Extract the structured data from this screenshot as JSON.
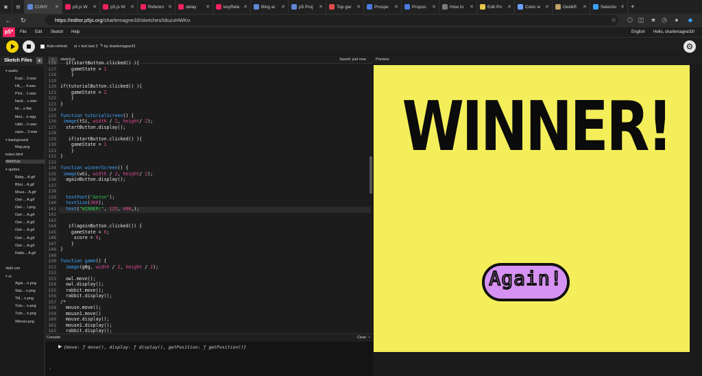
{
  "browser": {
    "tabs": [
      {
        "label": "CUNY",
        "color": "#5e88d8"
      },
      {
        "label": "p5.js W",
        "color": "#ed225d"
      },
      {
        "label": "p5.js W",
        "color": "#ed225d"
      },
      {
        "label": "Referen",
        "color": "#ed225d"
      },
      {
        "label": "delay",
        "color": "#ed225d"
      },
      {
        "label": "keyRele",
        "color": "#ed225d"
      },
      {
        "label": "Blog ar",
        "color": "#5e88d8"
      },
      {
        "label": "p5 Proj",
        "color": "#5e88d8"
      },
      {
        "label": "Top gar",
        "color": "#e34b4b"
      },
      {
        "label": "Prospe",
        "color": "#4b7be3"
      },
      {
        "label": "Propos",
        "color": "#4b7be3"
      },
      {
        "label": "How to",
        "color": "#7a7a7a"
      },
      {
        "label": "Edit Po",
        "color": "#e6c84a"
      },
      {
        "label": "Color w",
        "color": "#6aa0ff"
      },
      {
        "label": "Owl&R",
        "color": "#c2a06a"
      },
      {
        "label": "Selectio",
        "color": "#3aa2ff"
      }
    ],
    "url_host": "https://editor.p5js.org",
    "url_path": "/sharlemagne33/sketches/IduzuHWKo"
  },
  "header": {
    "logo": "p5*",
    "menu": [
      "File",
      "Edit",
      "Sketch",
      "Help"
    ],
    "language": "English",
    "user": "Hello, sharlemagne33!"
  },
  "toolbar": {
    "autorefresh_label": "Auto-refresh",
    "sketch_name": "ui + text test 2",
    "by_label": "by sharlemagne33"
  },
  "sidebar": {
    "title": "Sketch Files",
    "items": [
      {
        "label": "audio",
        "folder": true
      },
      {
        "label": "Expl... 3.wav"
      },
      {
        "label": "Hit_... 4.wav"
      },
      {
        "label": "Pick... 1.wav"
      },
      {
        "label": "back... c.wav"
      },
      {
        "label": "bir... s.flac"
      },
      {
        "label": "bloo... e.ogg"
      },
      {
        "label": "rabb... h.wav"
      },
      {
        "label": "sque... 3.wav"
      },
      {
        "label": "background",
        "folder": true
      },
      {
        "label": "Map.png"
      },
      {
        "label": "index.html"
      },
      {
        "label": "sketch.js",
        "selected": true
      },
      {
        "label": "sprites",
        "folder": true
      },
      {
        "label": "Baby... A.gif"
      },
      {
        "label": "Bloo... A.gif"
      },
      {
        "label": "Mous... A.gif"
      },
      {
        "label": "Owl-... A.gif"
      },
      {
        "label": "Owl-... I.png"
      },
      {
        "label": "Owl-... A.gif"
      },
      {
        "label": "Owl-... A.gif"
      },
      {
        "label": "Owl-... A.gif"
      },
      {
        "label": "Owl-... A.gif"
      },
      {
        "label": "Owl-... A.gif"
      },
      {
        "label": "Rabb... A.gif"
      },
      {
        "label": "style.css"
      },
      {
        "label": "ui",
        "folder": true
      },
      {
        "label": "Agai... n.png"
      },
      {
        "label": "Star... n.png"
      },
      {
        "label": "Titl... n.png"
      },
      {
        "label": "Tuto... n.png"
      },
      {
        "label": "Tuto... n.png"
      },
      {
        "label": "Winner.png"
      }
    ]
  },
  "editor": {
    "tab": "sketch.js",
    "saved": "Saved: just now",
    "lines": [
      {
        "n": "116",
        "html": "  if(startButton.clicked() ){"
      },
      {
        "n": "117",
        "html": "    gameState = <span class='num'>1</span>"
      },
      {
        "n": "118",
        "html": "    }"
      },
      {
        "n": "119",
        "html": ""
      },
      {
        "n": "120",
        "html": "if(tutorialButton.clicked() ){"
      },
      {
        "n": "121",
        "html": "    gameState = <span class='num'>2</span>"
      },
      {
        "n": "122",
        "html": "    }"
      },
      {
        "n": "123",
        "html": "}"
      },
      {
        "n": "124",
        "html": ""
      },
      {
        "n": "125",
        "html": "<span class='kw'>function</span> <span class='kw'>tutorialScreen</span>() {"
      },
      {
        "n": "126",
        "html": " <span class='kw'>image</span>(tSi, <span class='num'>width</span> / <span class='num'>2</span>, <span class='num'>height</span>/ <span class='num'>2</span>);"
      },
      {
        "n": "127",
        "html": "  startButton.display();"
      },
      {
        "n": "128",
        "html": ""
      },
      {
        "n": "129",
        "html": "   if(startButton.clicked() ){"
      },
      {
        "n": "130",
        "html": "    gameState = <span class='num'>1</span>"
      },
      {
        "n": "131",
        "html": "    }"
      },
      {
        "n": "132",
        "html": "}"
      },
      {
        "n": "133",
        "html": ""
      },
      {
        "n": "134",
        "html": "<span class='kw'>function</span> <span class='kw'>winnerScreen</span>() {"
      },
      {
        "n": "135",
        "html": " <span class='kw'>image</span>(wSi, <span class='num'>width</span> / <span class='num'>2</span>, <span class='num'>height</span>/ <span class='num'>2</span>);"
      },
      {
        "n": "136",
        "html": "  againButton.display();"
      },
      {
        "n": "137",
        "html": ""
      },
      {
        "n": "138",
        "html": ""
      },
      {
        "n": "139",
        "html": "  <span class='kw'>textFont</span>(<span class='str'>\"Anton\"</span>);"
      },
      {
        "n": "140",
        "html": "  <span class='kw'>textSize</span>(<span class='num'>300</span>);"
      },
      {
        "n": "141",
        "html": "  <span class='kw'>text</span>(<span class='str'>\"WINNER!\"</span>, <span class='num'>125</span>, <span class='num'>400</span>,);"
      },
      {
        "n": "142",
        "html": ""
      },
      {
        "n": "143",
        "html": ""
      },
      {
        "n": "144",
        "html": "   if(againButton.clicked()) {"
      },
      {
        "n": "145",
        "html": "    gameState = <span class='num'>0</span>;"
      },
      {
        "n": "146",
        "html": "     score = <span class='num'>0</span>;"
      },
      {
        "n": "147",
        "html": "    }"
      },
      {
        "n": "148",
        "html": "}"
      },
      {
        "n": "149",
        "html": ""
      },
      {
        "n": "150",
        "html": "<span class='kw'>function</span> <span class='kw'>game</span>() {"
      },
      {
        "n": "151",
        "html": "  <span class='kw'>image</span>(gBg, <span class='num'>width</span> / <span class='num'>2</span>, <span class='num'>height</span> / <span class='num'>2</span>);"
      },
      {
        "n": "152",
        "html": ""
      },
      {
        "n": "153",
        "html": "  owl.move();"
      },
      {
        "n": "154",
        "html": "  owl.display();"
      },
      {
        "n": "155",
        "html": "  rabbit.move();"
      },
      {
        "n": "156",
        "html": "  rabbit.display();"
      },
      {
        "n": "157",
        "html": "/*"
      },
      {
        "n": "158",
        "html": "  mouse.move();"
      },
      {
        "n": "159",
        "html": "  mouse1.move()"
      },
      {
        "n": "160",
        "html": "  mouse.display();"
      },
      {
        "n": "161",
        "html": "  mouse1.display();"
      },
      {
        "n": "162",
        "html": "  rabbit.display();"
      }
    ]
  },
  "console": {
    "title": "Console",
    "clear": "Clear",
    "output": "{move: ƒ move(), display: ƒ display(), getPosition: ƒ getPosition()}"
  },
  "preview": {
    "title": "Preview",
    "canvas_text": "WINNER!",
    "button_text": "Again!",
    "canvas_color": "#f4ee5a",
    "button_color": "#d692f2"
  }
}
